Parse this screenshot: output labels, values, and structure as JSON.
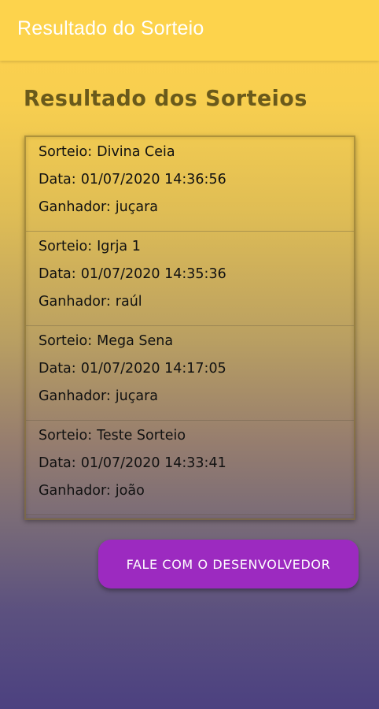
{
  "app_bar": {
    "title": "Resultado do Sorteio"
  },
  "page": {
    "heading": "Resultado dos Sorteios"
  },
  "labels": {
    "sorteio": "Sorteio:",
    "data": "Data:",
    "ganhador": "Ganhador:"
  },
  "results": [
    {
      "sorteio": "Divina Ceia",
      "data": "01/07/2020 14:36:56",
      "ganhador": "juçara"
    },
    {
      "sorteio": "Igrja 1",
      "data": "01/07/2020 14:35:36",
      "ganhador": "raúl"
    },
    {
      "sorteio": "Mega Sena",
      "data": "01/07/2020 14:17:05",
      "ganhador": "juçara"
    },
    {
      "sorteio": "Teste Sorteio",
      "data": "01/07/2020 14:33:41",
      "ganhador": "joão"
    }
  ],
  "actions": {
    "contact_developer": "FALE COM O DESENVOLVEDOR"
  },
  "colors": {
    "app_bar": "#fdd34c",
    "heading": "#6a5a1b",
    "button": "#9c2ac0",
    "gradient_top": "#fdd04e",
    "gradient_bottom": "#4c4180"
  }
}
